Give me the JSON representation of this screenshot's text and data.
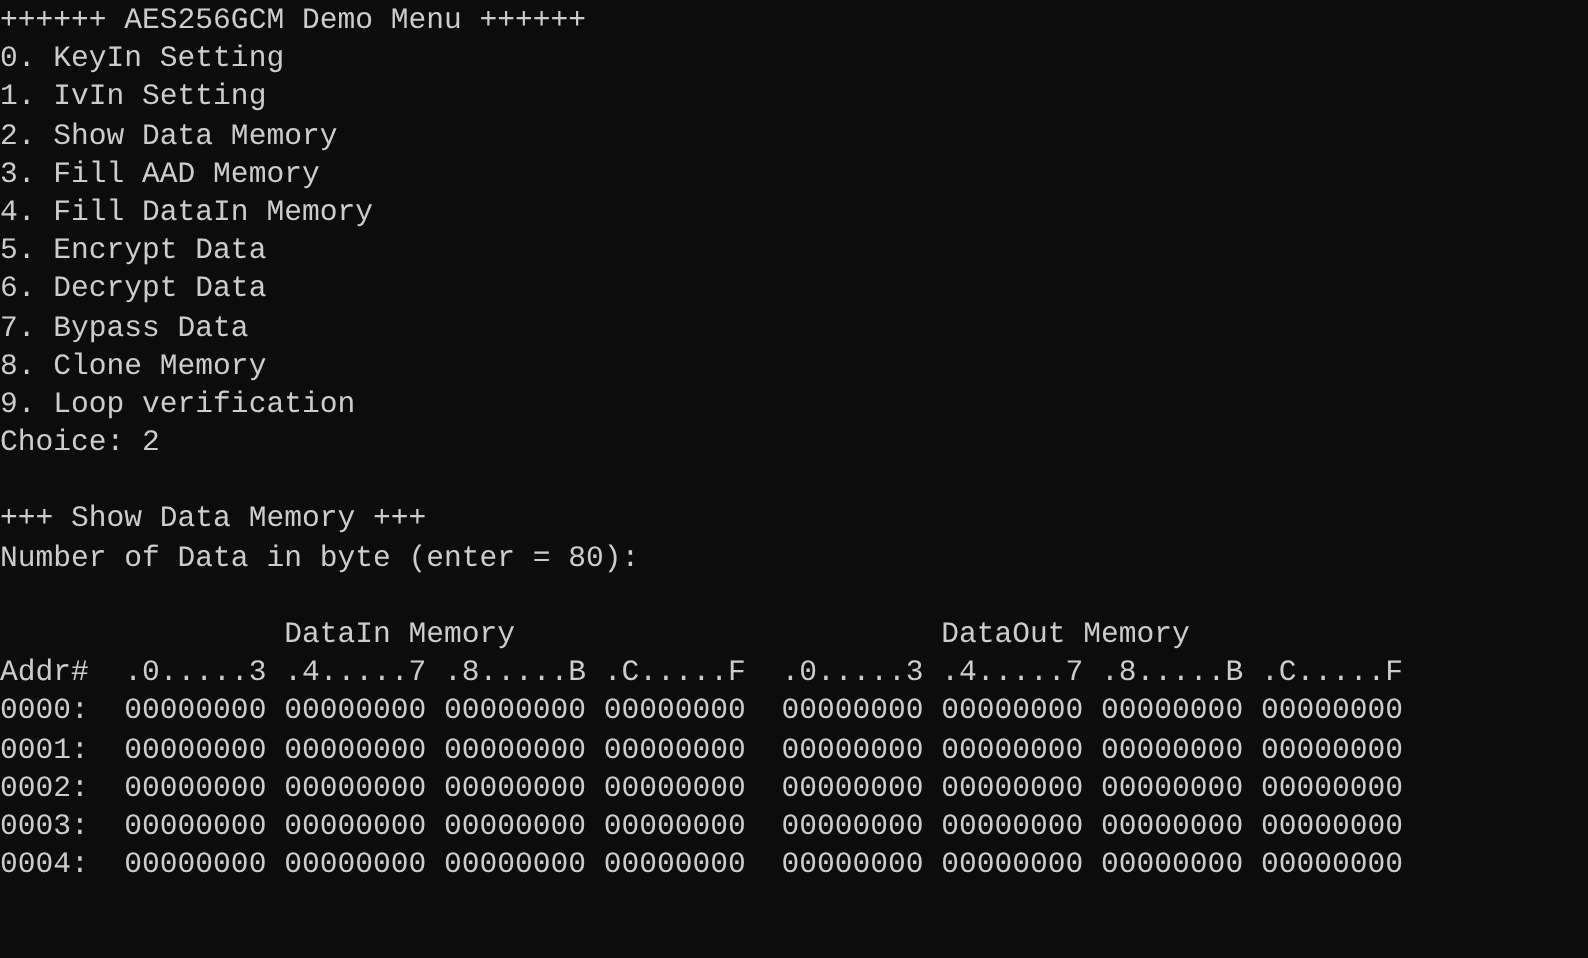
{
  "title": "++++++ AES256GCM Demo Menu ++++++",
  "menu_items": [
    "0. KeyIn Setting",
    "1. IvIn Setting",
    "2. Show Data Memory",
    "3. Fill AAD Memory",
    "4. Fill DataIn Memory",
    "5. Encrypt Data",
    "6. Decrypt Data",
    "7. Bypass Data",
    "8. Clone Memory",
    "9. Loop verification"
  ],
  "choice": {
    "prompt": "Choice:",
    "value": "2"
  },
  "section_title": "+++ Show Data Memory +++",
  "byte_prompt": "Number of Data in byte (enter = 80):",
  "memory_table": {
    "address_heading": "Addr#",
    "groups": [
      {
        "title": "DataIn Memory",
        "columns": [
          ".0.....3",
          ".4.....7",
          ".8.....B",
          ".C.....F"
        ]
      },
      {
        "title": "DataOut Memory",
        "columns": [
          ".0.....3",
          ".4.....7",
          ".8.....B",
          ".C.....F"
        ]
      }
    ],
    "rows": [
      {
        "address": "0000:",
        "datain": [
          "00000000",
          "00000000",
          "00000000",
          "00000000"
        ],
        "dataout": [
          "00000000",
          "00000000",
          "00000000",
          "00000000"
        ]
      },
      {
        "address": "0001:",
        "datain": [
          "00000000",
          "00000000",
          "00000000",
          "00000000"
        ],
        "dataout": [
          "00000000",
          "00000000",
          "00000000",
          "00000000"
        ]
      },
      {
        "address": "0002:",
        "datain": [
          "00000000",
          "00000000",
          "00000000",
          "00000000"
        ],
        "dataout": [
          "00000000",
          "00000000",
          "00000000",
          "00000000"
        ]
      },
      {
        "address": "0003:",
        "datain": [
          "00000000",
          "00000000",
          "00000000",
          "00000000"
        ],
        "dataout": [
          "00000000",
          "00000000",
          "00000000",
          "00000000"
        ]
      },
      {
        "address": "0004:",
        "datain": [
          "00000000",
          "00000000",
          "00000000",
          "00000000"
        ],
        "dataout": [
          "00000000",
          "00000000",
          "00000000",
          "00000000"
        ]
      }
    ]
  }
}
